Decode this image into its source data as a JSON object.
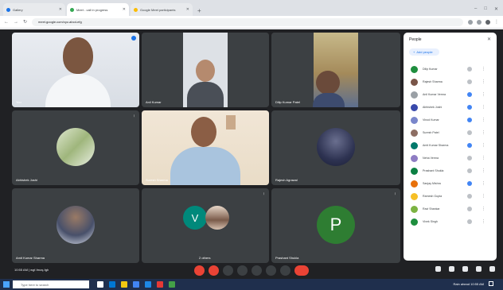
{
  "browser": {
    "tabs": [
      {
        "label": "Gallery"
      },
      {
        "label": "Meet - call in progress"
      },
      {
        "label": "Google Meet participants"
      }
    ],
    "url": "meet.google.com/xyz-abcd-efg"
  },
  "tiles": [
    {
      "name": "You",
      "kind": "video"
    },
    {
      "name": "Anil Kumar",
      "kind": "video"
    },
    {
      "name": "Dilip Kumar Patel",
      "kind": "video"
    },
    {
      "name": "Abhishek Joshi",
      "kind": "avatar"
    },
    {
      "name": "Suresh Sharma",
      "kind": "video"
    },
    {
      "name": "Rajesh Agrawal",
      "kind": "avatar"
    },
    {
      "name": "Amit Kumar Sharma",
      "kind": "avatar"
    },
    {
      "name": "2 others",
      "kind": "pair",
      "letter": "V"
    },
    {
      "name": "Prashant Shukla",
      "kind": "letter",
      "letter": "P"
    }
  ],
  "people_panel": {
    "title": "People",
    "add_label": "Add people",
    "participants": [
      {
        "name": "Dilip Kumar",
        "status": "grey",
        "color": "#1e8e3e"
      },
      {
        "name": "Rajesh Sharma",
        "status": "grey",
        "color": "#795548"
      },
      {
        "name": "Anil Kumar Verma",
        "status": "blue",
        "color": "#9aa0a6"
      },
      {
        "name": "Abhishek Joshi",
        "status": "blue",
        "color": "#3949ab"
      },
      {
        "name": "Vinod Kumar",
        "status": "blue",
        "color": "#7986cb"
      },
      {
        "name": "Suresh Patel",
        "status": "grey",
        "color": "#8d6e63"
      },
      {
        "name": "Amit Kumar Sharma",
        "status": "blue",
        "color": "#00796b"
      },
      {
        "name": "Neha Verma",
        "status": "grey",
        "color": "#8e7cc3"
      },
      {
        "name": "Prashant Shukla",
        "status": "grey",
        "color": "#0b8043"
      },
      {
        "name": "Sanjay Mishra",
        "status": "blue",
        "color": "#e8710a"
      },
      {
        "name": "Ramesh Gupta",
        "status": "grey",
        "color": "#f6bf26"
      },
      {
        "name": "Ravi Shankar",
        "status": "grey",
        "color": "#7cb342"
      },
      {
        "name": "Vivek Singh",
        "status": "grey",
        "color": "#1e8e3e"
      }
    ]
  },
  "meeting_info": "10:55 AM | wgf-fmzq-fgh",
  "taskbar": {
    "search_placeholder": "Type here to search",
    "tray_text": "Rain ahead   10:55 AM"
  },
  "colors": {
    "meet_bg": "#202124",
    "tile_bg": "#3c4043",
    "accent": "#1a73e8",
    "end_call": "#ea4335"
  }
}
